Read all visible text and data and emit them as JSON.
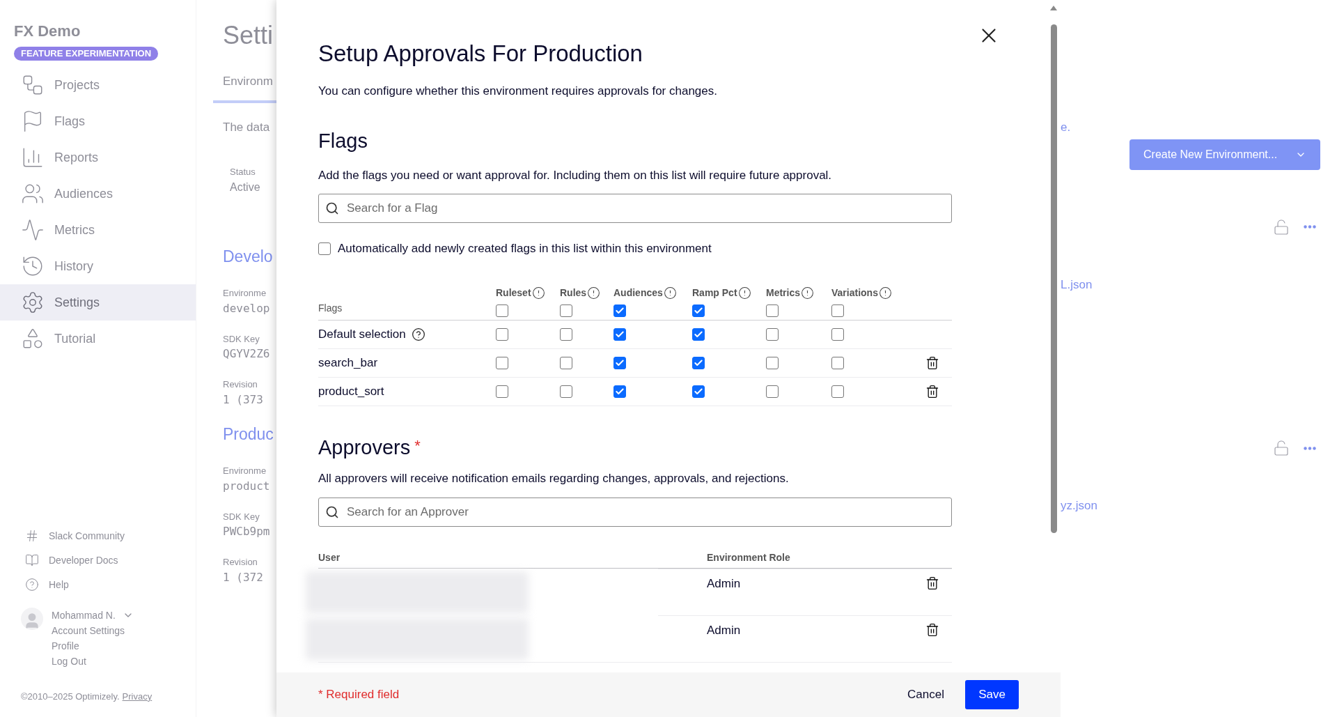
{
  "sidebar": {
    "title": "FX Demo",
    "badge": "FEATURE EXPERIMENTATION",
    "items": [
      {
        "label": "Projects",
        "selected": false
      },
      {
        "label": "Flags",
        "selected": false
      },
      {
        "label": "Reports",
        "selected": false
      },
      {
        "label": "Audiences",
        "selected": false
      },
      {
        "label": "Metrics",
        "selected": false
      },
      {
        "label": "History",
        "selected": false
      },
      {
        "label": "Settings",
        "selected": true
      },
      {
        "label": "Tutorial",
        "selected": false
      }
    ],
    "links": [
      "Slack Community",
      "Developer Docs",
      "Help"
    ],
    "user": {
      "name": "Mohammad N.",
      "menu": [
        "Account Settings",
        "Profile",
        "Log Out"
      ]
    },
    "copyright": "©2010–2025 Optimizely.",
    "privacy": "Privacy"
  },
  "background": {
    "left": [
      {
        "kind": "heading",
        "text": "Setti"
      },
      {
        "kind": "tab",
        "text": "Environm"
      },
      {
        "kind": "text",
        "text": "The data"
      },
      {
        "kind": "label",
        "text": "Status"
      },
      {
        "kind": "value",
        "text": "Active"
      },
      {
        "kind": "section",
        "text": "Develo"
      },
      {
        "kind": "label",
        "text": "Environme"
      },
      {
        "kind": "mono",
        "text": "develop"
      },
      {
        "kind": "label",
        "text": "SDK Key"
      },
      {
        "kind": "mono",
        "text": "QGYV2Z6"
      },
      {
        "kind": "label",
        "text": "Revision"
      },
      {
        "kind": "mono",
        "text": "1 (373"
      },
      {
        "kind": "section",
        "text": "Produc"
      },
      {
        "kind": "label",
        "text": "Environme"
      },
      {
        "kind": "mono",
        "text": "product"
      },
      {
        "kind": "label",
        "text": "SDK Key"
      },
      {
        "kind": "mono",
        "text": "PWCb9pm"
      },
      {
        "kind": "label",
        "text": "Revision"
      },
      {
        "kind": "mono",
        "text": "1 (372"
      }
    ],
    "right_text": "e.",
    "create_button": "Create New Environment...",
    "files": [
      "L.json",
      "yz.json"
    ]
  },
  "modal": {
    "title": "Setup Approvals For Production",
    "description": "You can configure whether this environment requires approvals for changes.",
    "flags": {
      "heading": "Flags",
      "description": "Add the flags you need or want approval for. Including them on this list will require future approval.",
      "search": {
        "placeholder": "Search for a Flag"
      },
      "auto_add": {
        "label": "Automatically add newly created flags in this list within this environment",
        "checked": false
      },
      "first_column": "Flags",
      "columns": [
        "Ruleset",
        "Rules",
        "Audiences",
        "Ramp Pct",
        "Metrics",
        "Variations"
      ],
      "header_checks": [
        false,
        false,
        true,
        true,
        false,
        false
      ],
      "rows": [
        {
          "kind": "default",
          "name": "Default selection",
          "checks": [
            false,
            false,
            true,
            true,
            false,
            false
          ]
        },
        {
          "kind": "flag",
          "name": "search_bar",
          "checks": [
            false,
            false,
            true,
            true,
            false,
            false
          ]
        },
        {
          "kind": "flag",
          "name": "product_sort",
          "checks": [
            false,
            false,
            true,
            true,
            false,
            false
          ]
        }
      ]
    },
    "approvers": {
      "heading": "Approvers",
      "required_mark": "*",
      "description": "All approvers will receive notification emails regarding changes, approvals, and rejections.",
      "search": {
        "placeholder": "Search for an Approver"
      },
      "columns": [
        "User",
        "Environment Role"
      ],
      "rows": [
        {
          "role": "Admin"
        },
        {
          "role": "Admin"
        }
      ]
    },
    "footer": {
      "required_note": "* Required field",
      "cancel": "Cancel",
      "save": "Save"
    }
  }
}
